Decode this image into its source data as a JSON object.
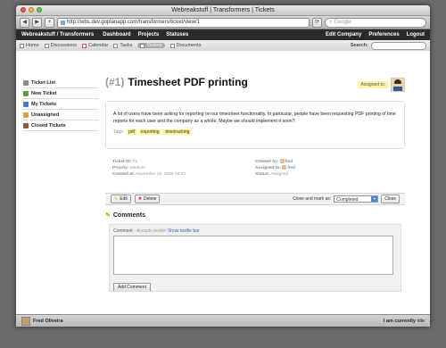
{
  "window": {
    "title": "Webreakstuff | Transformers | Tickets"
  },
  "browser": {
    "back": "◀",
    "forward": "▶",
    "add": "+",
    "reload": "⟳",
    "url": "http://wbs.dev.goplanapp.com/transformers/ticket/view/1",
    "search_placeholder": "Google"
  },
  "appbar": {
    "brand": "Webreakstuff / Transformers",
    "nav": [
      "Dashboard",
      "Projects",
      "Statuses"
    ],
    "right": [
      "Edit Company",
      "Preferences",
      "Logout"
    ]
  },
  "subnav": {
    "items": [
      "Home",
      "Discussions",
      "Calendar",
      "Tasks",
      "Tickets",
      "Documents"
    ],
    "search_label": "Search:"
  },
  "sidebar": {
    "items": [
      "Ticket List",
      "New Ticket",
      "My Tickets",
      "Unassigned",
      "Closed Tickets"
    ]
  },
  "ticket": {
    "number": "(#1)",
    "title": "Timesheet PDF printing",
    "assigned_label": "Assigned to:",
    "description": "A lot of users have been asking for reporting on our timesheet functionality. In particular, people have been requesting PDF printing of time reports for each user and the company as a whole. Maybe we should implement it soon?",
    "tags_label": "Tags:",
    "tags": [
      "pdf",
      "exporting",
      "timetracking"
    ],
    "meta_left": {
      "ticket_id_label": "Ticket ID:",
      "ticket_id": "#1",
      "priority_label": "Priority:",
      "priority": "Medium",
      "created_at_label": "Created at:",
      "created_at": "November 24, 2009 18:43"
    },
    "meta_right": {
      "created_by_label": "Created by:",
      "created_by": "fred",
      "assigned_to_label": "Assigned to:",
      "assigned_to": "fred",
      "status_label": "Status:",
      "status": "Assigned"
    }
  },
  "actions": {
    "edit": "Edit",
    "delete": "Delete",
    "close_label": "Close and mark as:",
    "close_select": "Completed",
    "close_button": "Close"
  },
  "comments": {
    "heading": "Comments",
    "label": "Comment",
    "hint": "- Accepts textile!",
    "toolbar_link": "Show textile bar",
    "add_button": "Add Comment"
  },
  "statusbar": {
    "user": "Fred Oliveira",
    "status_prefix": "I am currently",
    "status": "idle"
  }
}
